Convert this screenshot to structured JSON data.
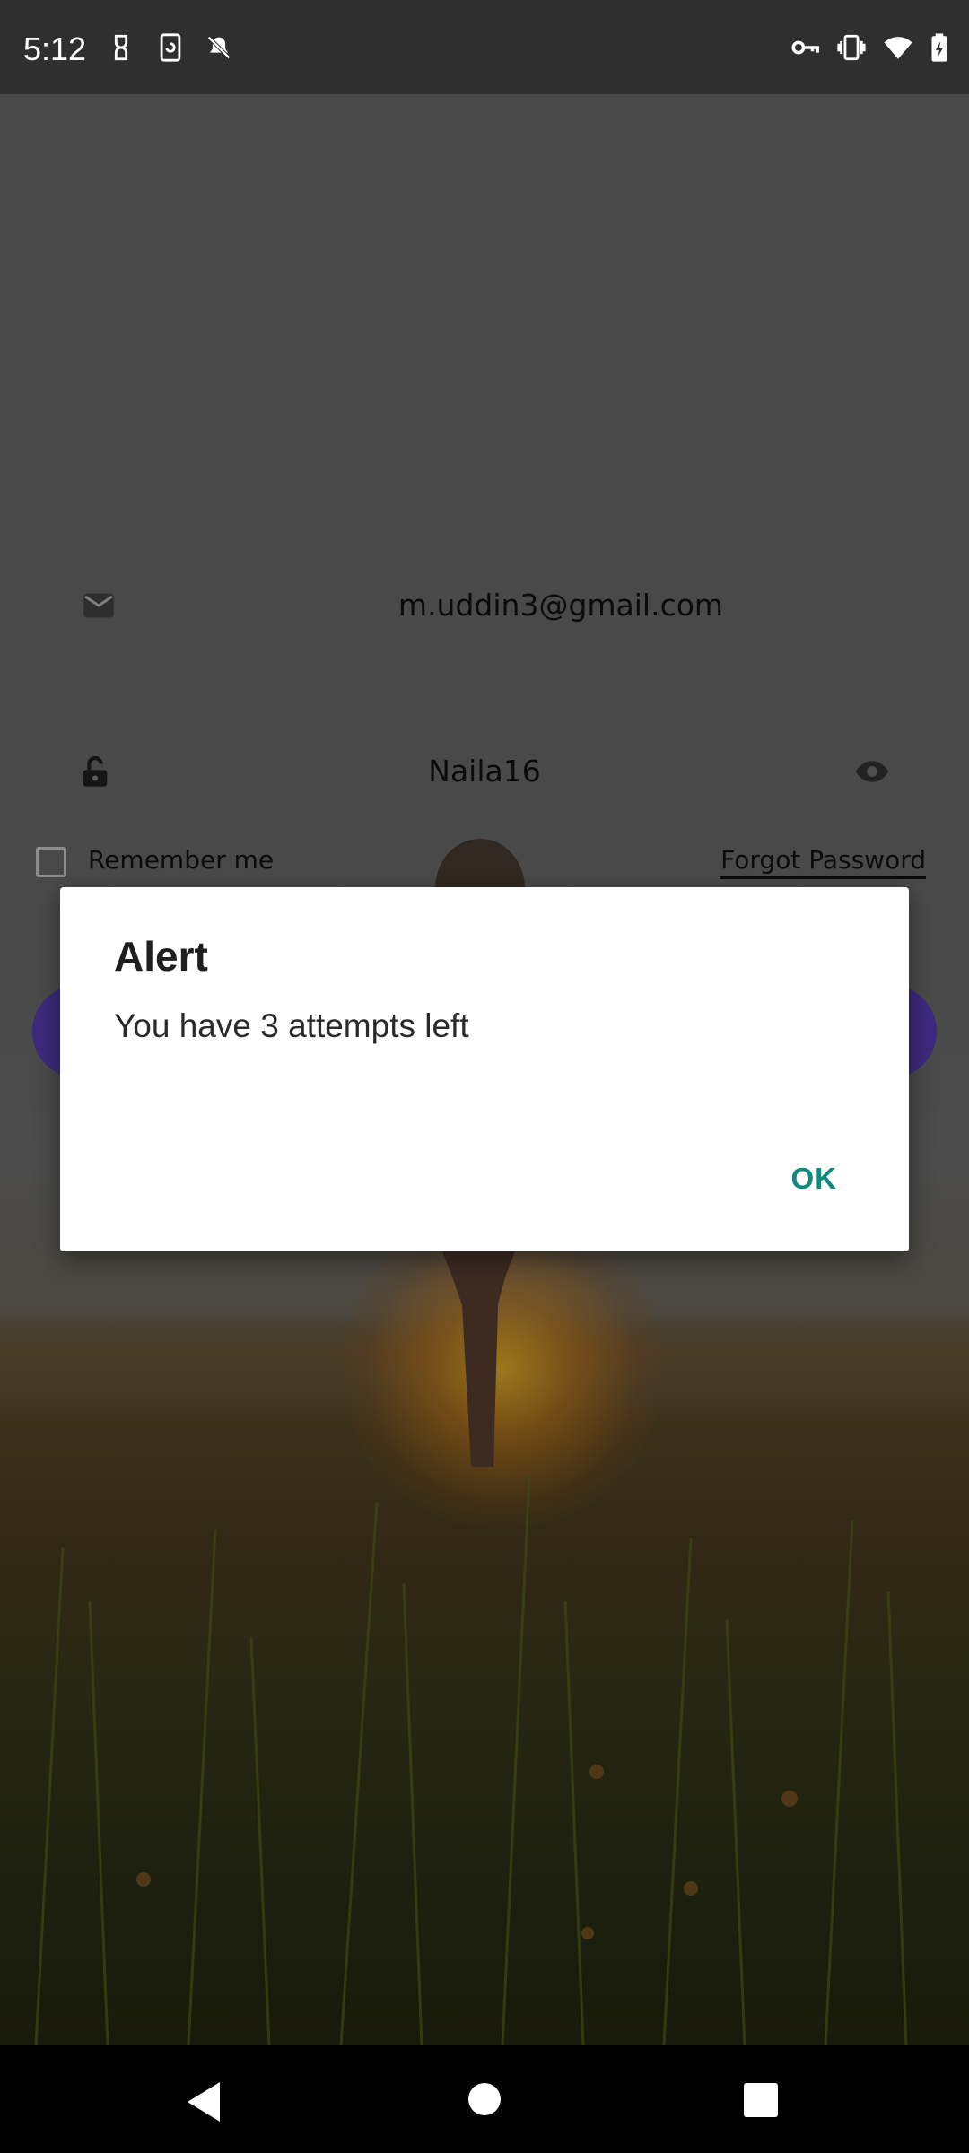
{
  "status_bar": {
    "time": "5:12",
    "left_icons": [
      "link-icon",
      "phone-rotate-icon",
      "notifications-off-icon"
    ],
    "right_icons": [
      "vpn-key-icon",
      "vibrate-icon",
      "wifi-icon",
      "battery-charging-icon"
    ]
  },
  "login": {
    "email_icon": "mail-icon",
    "email_value": "m.uddin3@gmail.com",
    "password_icon": "unlock-icon",
    "password_value": "Naila16",
    "password_toggle_icon": "eye-icon",
    "remember_label": "Remember me",
    "remember_checked": false,
    "forgot_label": "Forgot Password",
    "login_button_color": "#5b3fb8"
  },
  "dialog": {
    "title": "Alert",
    "message": "You have 3 attempts left",
    "ok_label": "OK",
    "ok_color": "#0f8b7e"
  },
  "nav_bar": {
    "icons": [
      "back-icon",
      "home-icon",
      "recents-icon"
    ]
  }
}
